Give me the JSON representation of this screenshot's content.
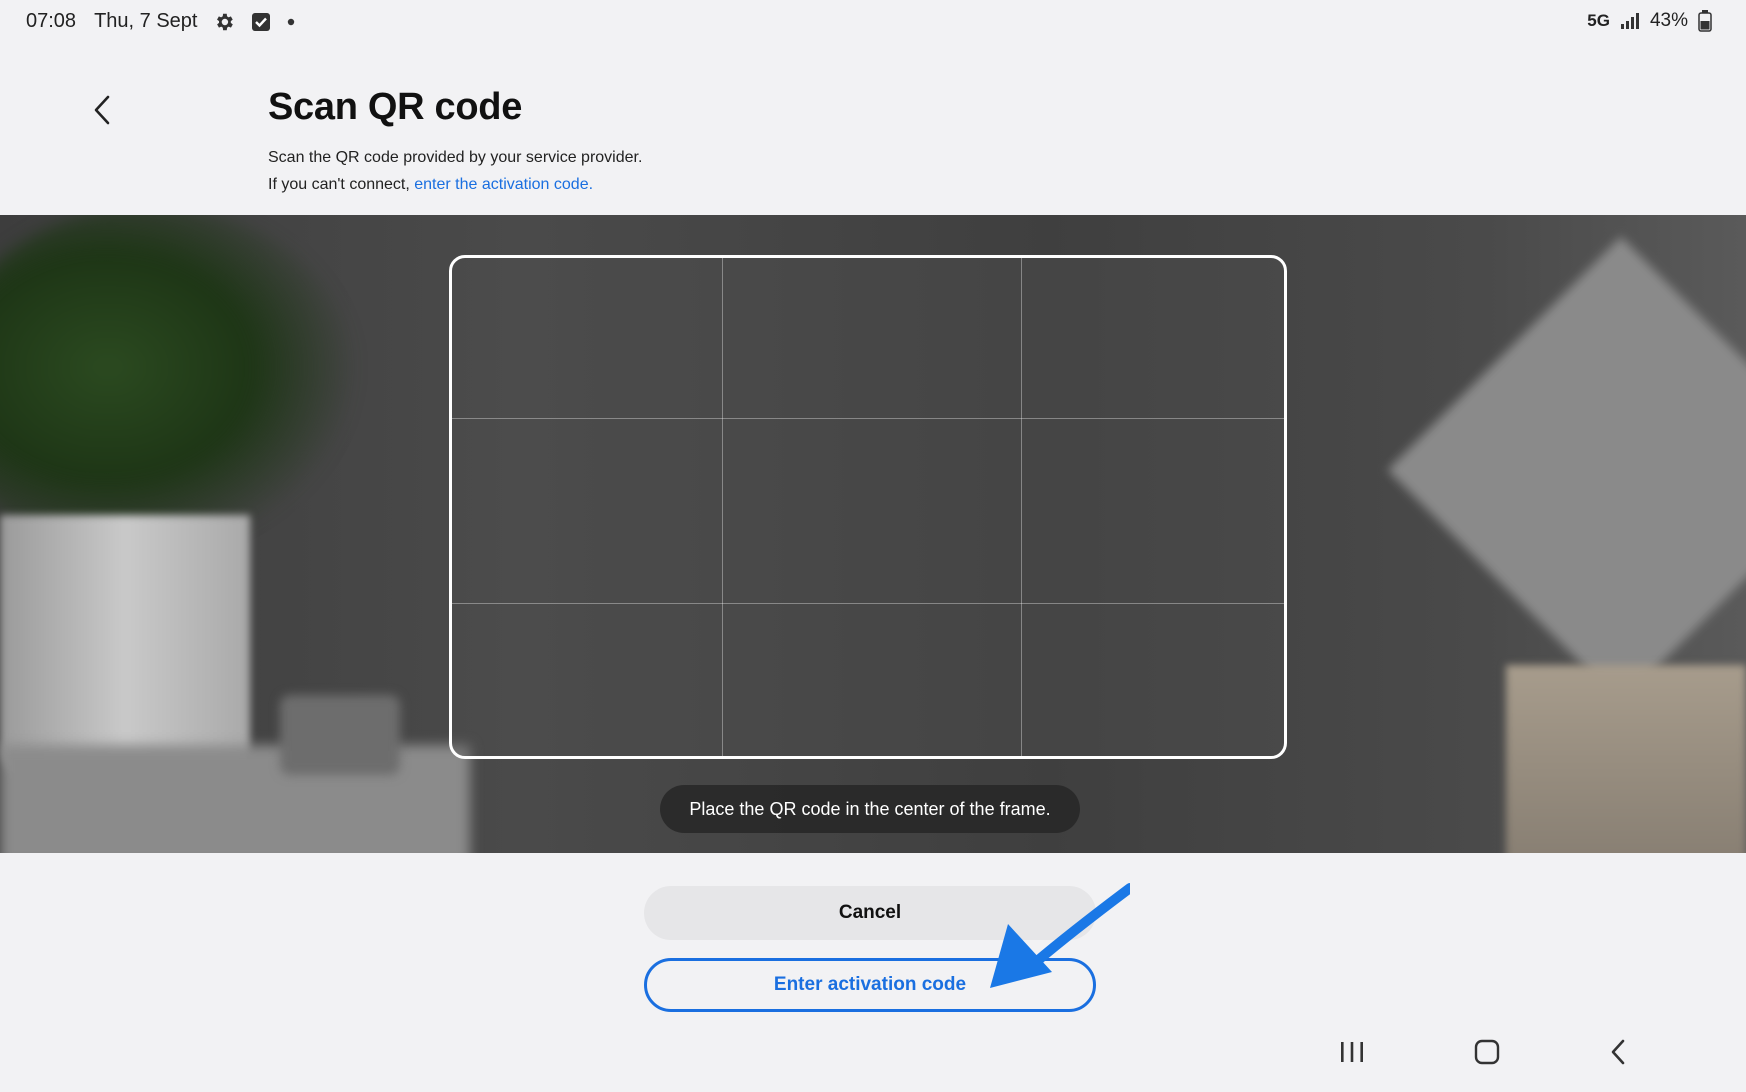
{
  "status_bar": {
    "time": "07:08",
    "date": "Thu, 7 Sept",
    "icons": [
      "gear-icon",
      "checkbox-icon",
      "dot-icon"
    ],
    "network": "5G",
    "battery": "43%"
  },
  "header": {
    "title": "Scan QR code",
    "description_line1": "Scan the QR code provided by your service provider.",
    "description_line2_prefix": "If you can't connect, ",
    "description_link": "enter the activation code."
  },
  "camera": {
    "hint": "Place the QR code in the center of the frame."
  },
  "buttons": {
    "cancel": "Cancel",
    "enter_activation": "Enter activation code"
  },
  "colors": {
    "accent": "#1a6fe0",
    "annotation_arrow": "#1a78e6"
  },
  "navbar": {
    "icons": [
      "recents-icon",
      "home-icon",
      "back-icon"
    ]
  }
}
